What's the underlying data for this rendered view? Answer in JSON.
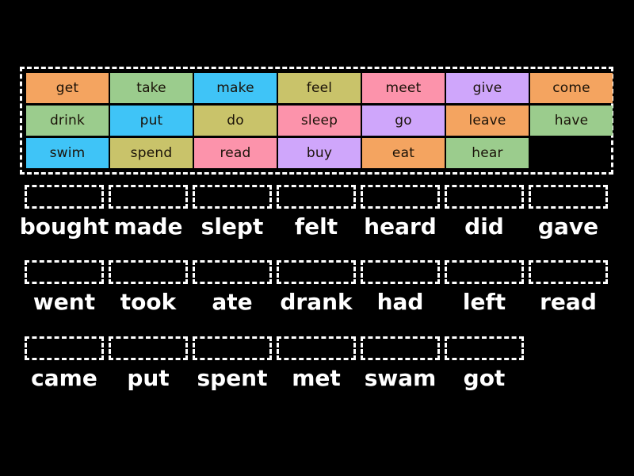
{
  "theme": {
    "background": "#000000",
    "dash_border": "#ffffff",
    "label_text": "#ffffff",
    "tile_text": "#1a1208",
    "palette": {
      "orange": "#f4a460",
      "green": "#9bcc8d",
      "blue": "#3fc4f7",
      "olive": "#c9c36a",
      "pink": "#fc93ab",
      "purple": "#cfa6fb"
    }
  },
  "tile_bank": {
    "rows": [
      [
        {
          "label": "get",
          "color": "#f4a460"
        },
        {
          "label": "take",
          "color": "#9bcc8d"
        },
        {
          "label": "make",
          "color": "#3fc4f7"
        },
        {
          "label": "feel",
          "color": "#c9c36a"
        },
        {
          "label": "meet",
          "color": "#fc93ab"
        },
        {
          "label": "give",
          "color": "#cfa6fb"
        },
        {
          "label": "come",
          "color": "#f4a460"
        }
      ],
      [
        {
          "label": "drink",
          "color": "#9bcc8d"
        },
        {
          "label": "put",
          "color": "#3fc4f7"
        },
        {
          "label": "do",
          "color": "#c9c36a"
        },
        {
          "label": "sleep",
          "color": "#fc93ab"
        },
        {
          "label": "go",
          "color": "#cfa6fb"
        },
        {
          "label": "leave",
          "color": "#f4a460"
        },
        {
          "label": "have",
          "color": "#9bcc8d"
        }
      ],
      [
        {
          "label": "swim",
          "color": "#3fc4f7"
        },
        {
          "label": "spend",
          "color": "#c9c36a"
        },
        {
          "label": "read",
          "color": "#fc93ab"
        },
        {
          "label": "buy",
          "color": "#cfa6fb"
        },
        {
          "label": "eat",
          "color": "#f4a460"
        },
        {
          "label": "hear",
          "color": "#9bcc8d"
        },
        {
          "label": "",
          "color": "transparent",
          "empty": true
        }
      ]
    ]
  },
  "answer_rows": [
    {
      "cells": [
        {
          "label": "bought",
          "dropzone_value": ""
        },
        {
          "label": "made",
          "dropzone_value": ""
        },
        {
          "label": "slept",
          "dropzone_value": ""
        },
        {
          "label": "felt",
          "dropzone_value": ""
        },
        {
          "label": "heard",
          "dropzone_value": ""
        },
        {
          "label": "did",
          "dropzone_value": ""
        },
        {
          "label": "gave",
          "dropzone_value": ""
        }
      ]
    },
    {
      "cells": [
        {
          "label": "went",
          "dropzone_value": ""
        },
        {
          "label": "took",
          "dropzone_value": ""
        },
        {
          "label": "ate",
          "dropzone_value": ""
        },
        {
          "label": "drank",
          "dropzone_value": ""
        },
        {
          "label": "had",
          "dropzone_value": ""
        },
        {
          "label": "left",
          "dropzone_value": ""
        },
        {
          "label": "read",
          "dropzone_value": ""
        }
      ]
    },
    {
      "cells": [
        {
          "label": "came",
          "dropzone_value": ""
        },
        {
          "label": "put",
          "dropzone_value": ""
        },
        {
          "label": "spent",
          "dropzone_value": ""
        },
        {
          "label": "met",
          "dropzone_value": ""
        },
        {
          "label": "swam",
          "dropzone_value": ""
        },
        {
          "label": "got",
          "dropzone_value": ""
        }
      ]
    }
  ]
}
